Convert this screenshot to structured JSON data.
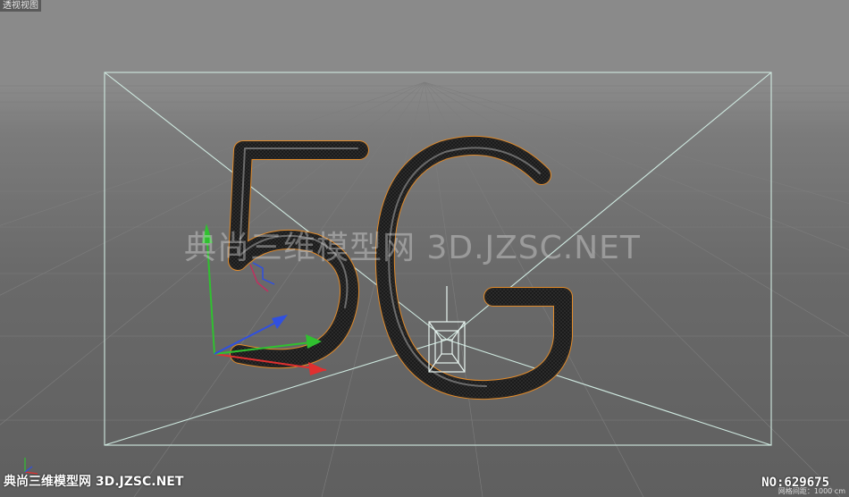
{
  "viewport": {
    "label": "透视视图",
    "grid_distance": "网格间距：1000 cm"
  },
  "watermark": {
    "text": "典尚三维模型网 3D.JZSC.NET"
  },
  "footer": {
    "brand": "典尚三维模型网 3D.JZSC.NET",
    "id_text": "NO:629675"
  },
  "model": {
    "text": "5G"
  },
  "colors": {
    "outline": "#e08a2a",
    "frame": "#cfe9e0",
    "axis_x": "#e03030",
    "axis_y": "#30c030",
    "axis_z": "#3050e0"
  }
}
